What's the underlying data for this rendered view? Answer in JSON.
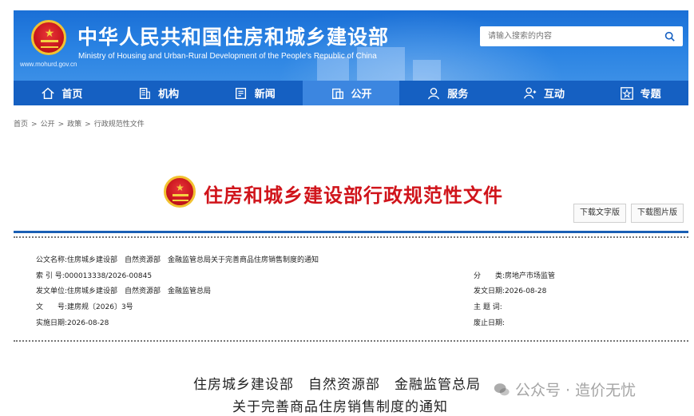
{
  "header": {
    "site_title": "中华人民共和国住房和城乡建设部",
    "site_subtitle": "Ministry of Housing and Urban-Rural Development of the People's Republic of China",
    "site_url": "www.mohurd.gov.cn",
    "search_placeholder": "请输入搜索的内容",
    "brand_color": "#1a6fd6"
  },
  "nav": {
    "items": [
      {
        "label": "首页",
        "icon": "home-icon"
      },
      {
        "label": "机构",
        "icon": "building-icon"
      },
      {
        "label": "新闻",
        "icon": "news-icon"
      },
      {
        "label": "公开",
        "icon": "folder-icon",
        "active": true
      },
      {
        "label": "服务",
        "icon": "service-icon"
      },
      {
        "label": "互动",
        "icon": "interact-icon"
      },
      {
        "label": "专题",
        "icon": "star-icon"
      }
    ]
  },
  "breadcrumb": [
    "首页",
    "公开",
    "政策",
    "行政规范性文件"
  ],
  "doc_header": {
    "title": "住房和城乡建设部行政规范性文件",
    "download_text": "下载文字版",
    "download_image": "下载图片版",
    "title_color": "#d0141b"
  },
  "meta": {
    "doc_name_label": "公文名称:",
    "doc_name": "住房城乡建设部　自然资源部　金融监管总局关于完善商品住房销售制度的通知",
    "index_label": "索 引 号:",
    "index": "000013338/2026-00845",
    "issuer_label": "发文单位:",
    "issuer": "住房城乡建设部　自然资源部　金融监管总局",
    "number_label": "文　　号:",
    "number": "建房规〔2026〕3号",
    "effective_label": "实施日期:",
    "effective": "2026-08-28",
    "category_label": "分　　类:",
    "category": "房地产市场监管",
    "issue_date_label": "发文日期:",
    "issue_date": "2026-08-28",
    "subject_label": "主 题 词:",
    "subject": "",
    "expiry_label": "废止日期:",
    "expiry": ""
  },
  "body": {
    "title_line1": "住房城乡建设部　自然资源部　金融监管总局",
    "title_line2": "关于完善商品住房销售制度的通知"
  },
  "watermark": {
    "text": "公众号 · 造价无忧"
  }
}
